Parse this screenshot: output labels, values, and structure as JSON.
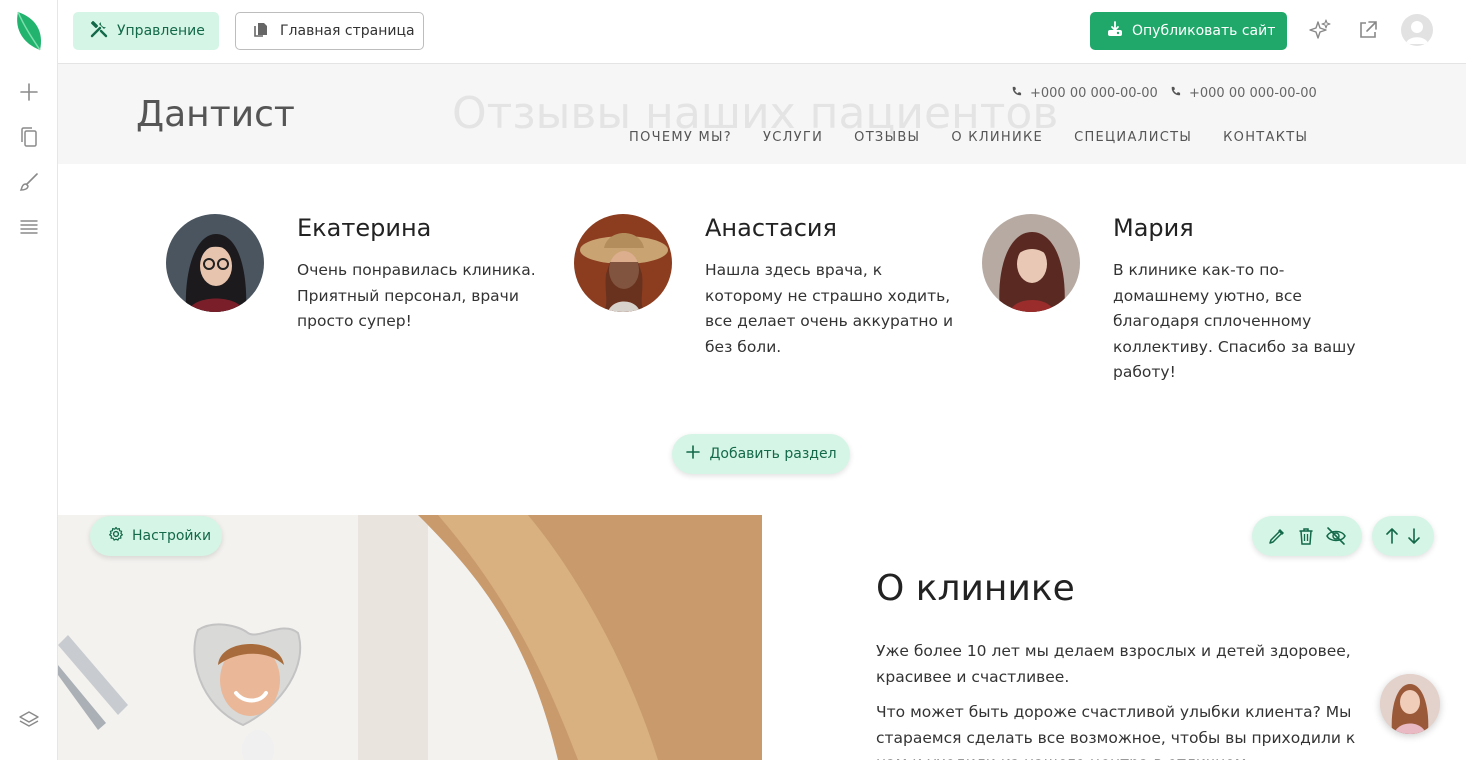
{
  "topbar": {
    "manage_label": "Управление",
    "home_label": "Главная страница",
    "publish_label": "Опубликовать сайт"
  },
  "site": {
    "logo": "Дантист",
    "ghost_heading": "Отзывы наших пациентов",
    "phones": [
      "+000 00 000-00-00",
      "+000 00 000-00-00"
    ],
    "nav": [
      "ПОЧЕМУ МЫ?",
      "УСЛУГИ",
      "ОТЗЫВЫ",
      "О КЛИНИКЕ",
      "СПЕЦИАЛИСТЫ",
      "КОНТАКТЫ"
    ]
  },
  "reviews": [
    {
      "name": "Екатерина",
      "text": "Очень понравилась клиника. Приятный персонал, врачи просто супер!"
    },
    {
      "name": "Анастасия",
      "text": "Нашла здесь врача, к которому не страшно ходить, все делает очень аккуратно и без боли."
    },
    {
      "name": "Мария",
      "text": "В клинике как-то по-домашнему уютно, все благодаря сплоченному коллективу. Спасибо за вашу работу!"
    }
  ],
  "add_section_label": "Добавить раздел",
  "settings_label": "Настройки",
  "about": {
    "title": "О клинике",
    "paragraphs": [
      "Уже более 10 лет мы делаем взрослых и детей здоровее, красивее и счастливее.",
      "Что может быть дороже счастливой улыбки клиента? Мы стараемся сделать все возможное, чтобы вы приходили к нам и уходили из нашего центра в отличном"
    ]
  },
  "colors": {
    "accent": "#1fa86a",
    "accent_soft": "#d5f5e6",
    "accent_text": "#14694a"
  }
}
